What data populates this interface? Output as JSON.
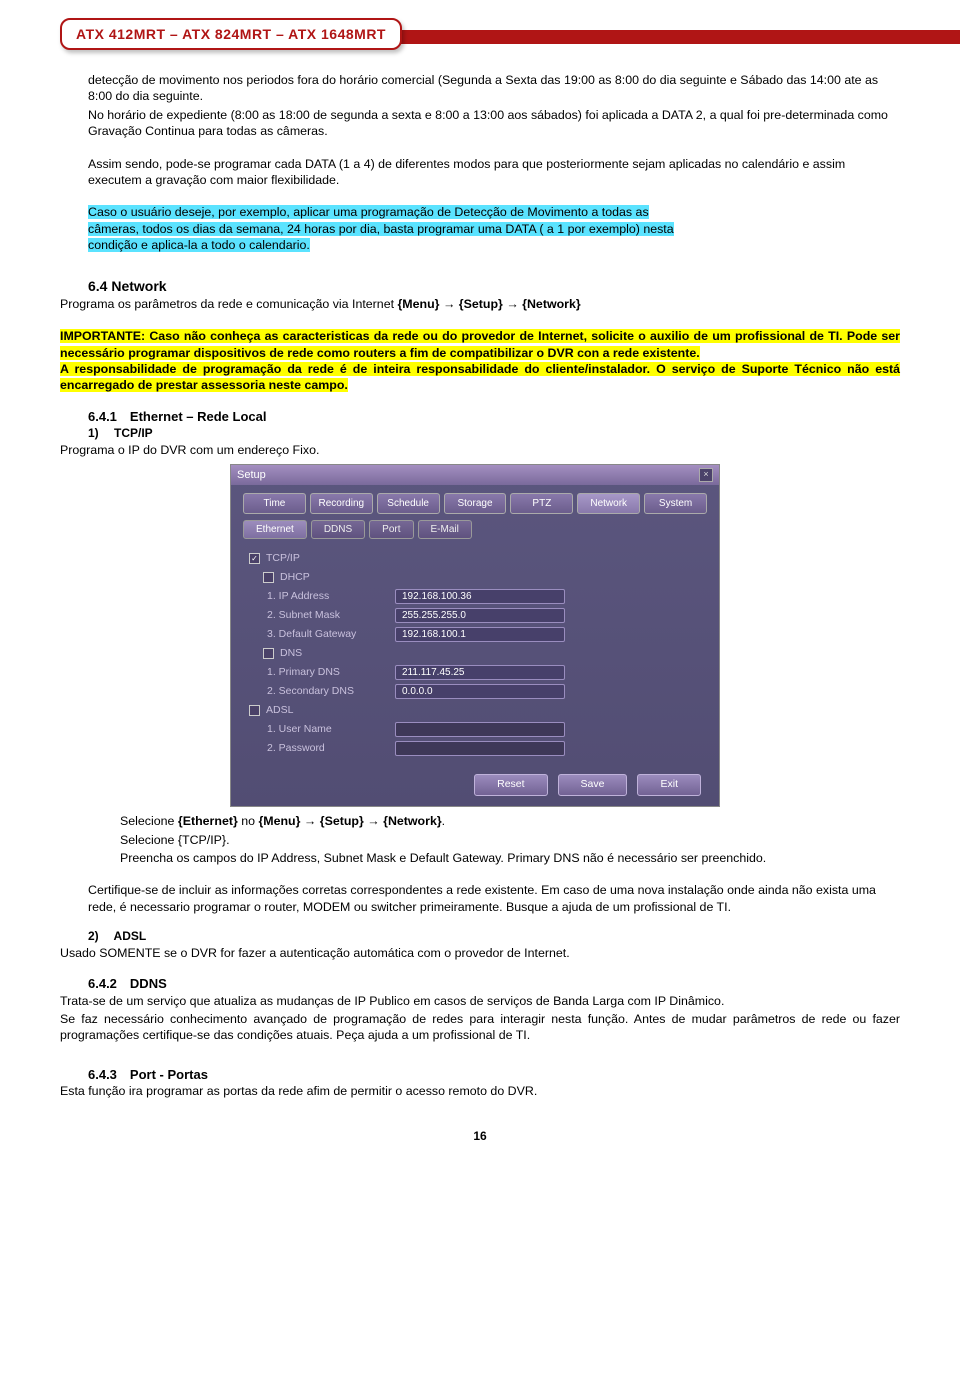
{
  "header": {
    "title": "ATX 412MRT – ATX 824MRT – ATX 1648MRT"
  },
  "intro": {
    "p1": "detecção de movimento nos periodos fora do horário comercial (Segunda a Sexta das 19:00 as 8:00 do dia seguinte e Sábado das 14:00 ate as 8:00 do dia seguinte.",
    "p2": "No horário de expediente (8:00 as 18:00 de segunda a sexta e 8:00 a 13:00 aos sábados) foi aplicada a DATA 2, a qual foi pre-determinada como Gravação Continua para todas as câmeras.",
    "p3": "Assim sendo, pode-se programar cada DATA (1 a 4) de diferentes modos para que posteriormente sejam aplicadas no calendário e assim executem a gravação com maior flexibilidade.",
    "p4a": "Caso o usuário deseje, por exemplo, aplicar uma programação de Detecção de Movimento a todas as",
    "p4b": "câmeras, todos os dias da semana, 24 horas por dia, basta programar uma DATA ( a 1 por exemplo) nesta",
    "p4c": "condição e aplica-la a todo o calendario."
  },
  "s64": {
    "title": "6.4 Network",
    "desc_a": "Programa os parâmetros da rede e comunicação via Internet ",
    "desc_b": "{Menu}",
    "desc_c": "{Setup}",
    "desc_d": "{Network}",
    "warn1": "IMPORTANTE: Caso não conheça as caracteristicas da rede ou do provedor de Internet, solicite o auxilio de um profissional de TI. Pode ser necessário programar dispositivos de rede como routers a fim de compatibilizar o DVR con a rede existente.",
    "warn2": "A responsabilidade de programação da rede é de inteira responsabilidade do cliente/instalador. O serviço de Suporte Técnico não está encarregado de prestar assessoria neste campo."
  },
  "s641": {
    "title": "6.4.1 Ethernet – Rede Local",
    "item1_label": "1)  TCP/IP",
    "item1_desc": "Programa o IP do DVR com um endereço Fixo.",
    "after_a": "Selecione ",
    "after_b": "{Ethernet}",
    "after_c": " no ",
    "after_d": "{Menu}",
    "after_e": "{Setup}",
    "after_f": "{Network}",
    "after2": "Selecione {TCP/IP}.",
    "after3": "Preencha os campos do IP Address, Subnet Mask e Default Gateway. Primary DNS não é necessário ser preenchido.",
    "after4": "Certifique-se de incluir as informações corretas correspondentes a rede existente. Em caso de uma nova instalação onde ainda não exista uma rede, é necessario programar o router, MODEM ou switcher primeiramente. Busque a ajuda de um profissional de TI.",
    "item2_label": "2)  ADSL",
    "item2_desc": "Usado SOMENTE se o DVR for fazer a autenticação automática com o provedor de Internet."
  },
  "s642": {
    "title": "6.4.2 DDNS",
    "p1": "Trata-se de um serviço que atualiza as mudanças de IP Publico em casos de serviços de Banda Larga com IP Dinâmico.",
    "p2": "Se faz necessário conhecimento avançado de programação de redes para interagir nesta função. Antes de mudar parâmetros de rede ou fazer programações certifique-se das condições atuais. Peça ajuda a um profissional de TI."
  },
  "s643": {
    "title": "6.4.3 Port - Portas",
    "p1": "Esta função ira programar as portas da rede afim de permitir o acesso remoto do DVR."
  },
  "dialog": {
    "title": "Setup",
    "tabs": [
      "Time",
      "Recording",
      "Schedule",
      "Storage",
      "PTZ",
      "Network",
      "System"
    ],
    "subtabs": [
      "Ethernet",
      "DDNS",
      "Port",
      "E-Mail"
    ],
    "tcpip": "TCP/IP",
    "dhcp": "DHCP",
    "ip_label": "1. IP Address",
    "ip_val": "192.168.100.36",
    "mask_label": "2. Subnet Mask",
    "mask_val": "255.255.255.0",
    "gw_label": "3. Default Gateway",
    "gw_val": "192.168.100.1",
    "dns": "DNS",
    "dns1_label": "1. Primary DNS",
    "dns1_val": "211.117.45.25",
    "dns2_label": "2. Secondary DNS",
    "dns2_val": "0.0.0.0",
    "adsl": "ADSL",
    "user_label": "1. User Name",
    "user_val": "",
    "pass_label": "2. Password",
    "pass_val": "",
    "btn_reset": "Reset",
    "btn_save": "Save",
    "btn_exit": "Exit"
  },
  "page_number": "16"
}
